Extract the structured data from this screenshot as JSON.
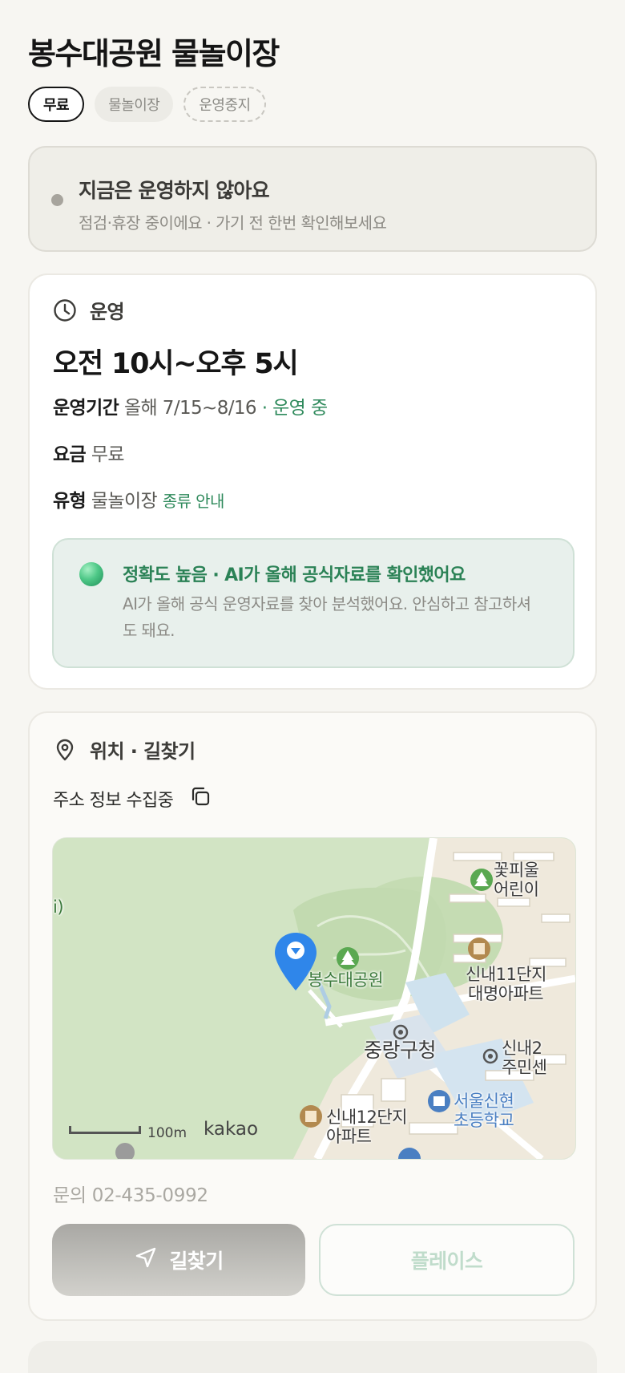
{
  "header": {
    "title": "봉수대공원 물놀이장"
  },
  "tags": {
    "fee": "무료",
    "type": "물놀이장",
    "status": "운영중지"
  },
  "status_banner": {
    "title": "지금은 운영하지 않아요",
    "subtitle": "점검·휴장 중이에요 · 가기 전 한번 확인해보세요"
  },
  "operation": {
    "section_title": "운영",
    "hours": "오전 10시~오후 5시",
    "period_label": "운영기간",
    "period_value": "올해 7/15~8/16",
    "period_status": "· 운영 중",
    "fee_label": "요금",
    "fee_value": "무료",
    "type_label": "유형",
    "type_value": "물놀이장",
    "type_link": "종류 안내",
    "ai": {
      "title": "정확도 높음 · AI가 올해 공식자료를 확인했어요",
      "description": "AI가 올해 공식 운영자료를 찾아 분석했어요. 안심하고 참고하셔도 돼요."
    }
  },
  "location": {
    "section_title": "위치 · 길찾기",
    "address": "주소 정보 수집중",
    "map": {
      "labels": {
        "park": "봉수대공원",
        "apt11_1": "신내11단지",
        "apt11_2": "대명아파트",
        "office": "중랑구청",
        "school_1": "서울신현",
        "school_2": "초등학교",
        "apt12_1": "신내12단지",
        "apt12_2": "아파트",
        "kinder_1": "꽃피울",
        "kinder_2": "어린이",
        "center_1": "신내2",
        "center_2": "주민센",
        "edge": "i)"
      },
      "scale": "100m",
      "brand": "kakao"
    },
    "contact": "문의 02-435-0992",
    "route_button": "길찾기",
    "place_button": "플레이스"
  },
  "colors": {
    "accent_green": "#2f8a5c",
    "pin_blue": "#2f86ea",
    "park_green": "#d2e4c4"
  }
}
